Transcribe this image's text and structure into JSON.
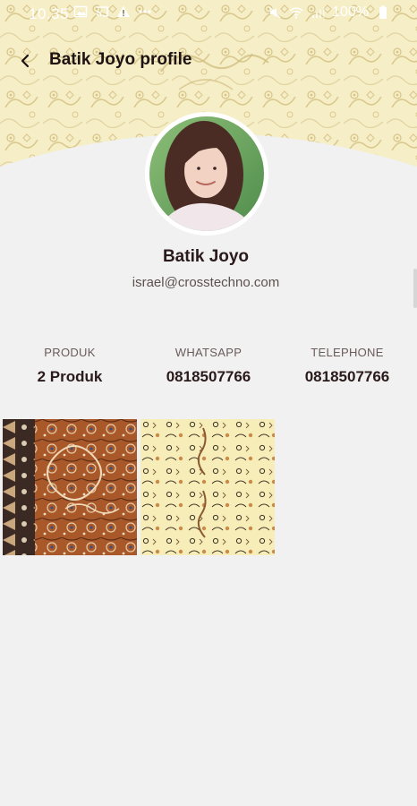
{
  "status_bar": {
    "time": "10.35",
    "left_icons": [
      "image-icon",
      "cast-icon",
      "warning-icon",
      "more-dots-icon"
    ],
    "right_icons": [
      "mute-icon",
      "wifi-icon",
      "signal-icon",
      "battery-icon"
    ],
    "battery": "100%"
  },
  "header": {
    "title": "Batik Joyo profile",
    "back_icon": "back-arrow-icon"
  },
  "profile": {
    "name": "Batik Joyo",
    "email": "israel@crosstechno.com"
  },
  "stats": [
    {
      "label": "PRODUK",
      "value": "2 Produk"
    },
    {
      "label": "WHATSAPP",
      "value": "0818507766"
    },
    {
      "label": "TELEPHONE",
      "value": "0818507766"
    }
  ],
  "products": [
    {
      "name": "batik-brown-fabric-image"
    },
    {
      "name": "batik-cream-fabric-image"
    }
  ],
  "colors": {
    "background": "#f1f1f1",
    "header_pattern": "#f6eec6",
    "text_primary": "#2a1a1a"
  }
}
